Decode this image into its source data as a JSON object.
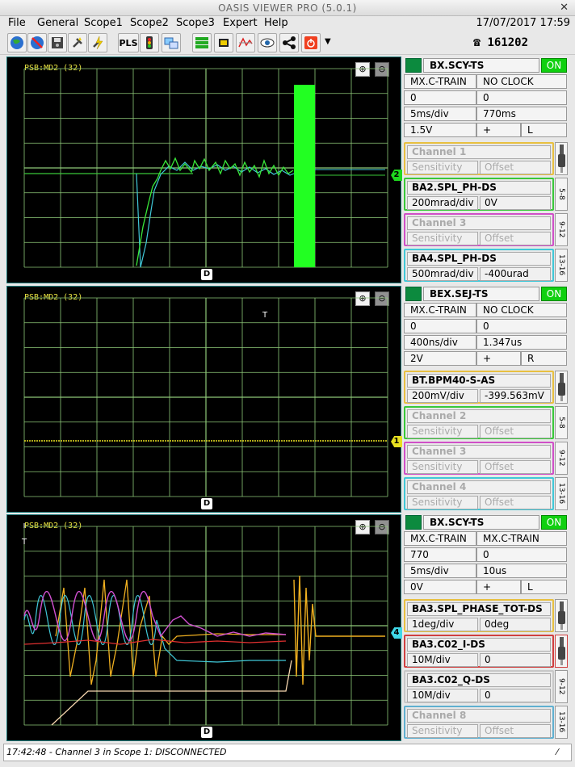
{
  "app": {
    "title": "OASIS VIEWER PRO (5.0.1)",
    "datetime": "17/07/2017 17:59",
    "phone": "161202"
  },
  "menu": [
    "File",
    "General",
    "Scope1",
    "Scope2",
    "Scope3",
    "Expert",
    "Help"
  ],
  "toolbar": {
    "pls": "PLS"
  },
  "scopes": [
    {
      "label": "PSB:MD2 (32)",
      "marker": "2",
      "marker_color": "#1ed81e",
      "dmark": "D",
      "side": {
        "timebase": "BX.SCY-TS",
        "state": "ON",
        "r1": [
          "MX.C-TRAIN",
          "NO CLOCK"
        ],
        "r2": [
          "0",
          "0"
        ],
        "r3": [
          "5ms/div",
          "770ms"
        ],
        "r4": [
          "1.5V",
          "+",
          "L"
        ],
        "channels": [
          {
            "name": "Channel 1",
            "sens": "Sensitivity",
            "off": "Offset",
            "enabled": false,
            "color": "#e8c040"
          },
          {
            "name": "BA2.SPL_PH-DS",
            "sens": "200mrad/div",
            "off": "0V",
            "enabled": true,
            "color": "#39c839"
          },
          {
            "name": "Channel 3",
            "sens": "Sensitivity",
            "off": "Offset",
            "enabled": false,
            "color": "#d050c8"
          },
          {
            "name": "BA4.SPL_PH-DS",
            "sens": "500mrad/div",
            "off": "-400urad",
            "enabled": true,
            "color": "#40c8d8"
          }
        ],
        "tabs": [
          "5-8",
          "9-12",
          "13-16"
        ]
      }
    },
    {
      "label": "PSB:MD2 (32)",
      "marker": "1",
      "marker_color": "#e8e020",
      "dmark": "D",
      "trigger": "T",
      "side": {
        "timebase": "BEX.SEJ-TS",
        "state": "ON",
        "r1": [
          "MX.C-TRAIN",
          "NO CLOCK"
        ],
        "r2": [
          "0",
          "0"
        ],
        "r3": [
          "400ns/div",
          "1.347us"
        ],
        "r4": [
          "2V",
          "+",
          "R"
        ],
        "channels": [
          {
            "name": "BT.BPM40-S-AS",
            "sens": "200mV/div",
            "off": "-399.563mV",
            "enabled": true,
            "color": "#e8c040"
          },
          {
            "name": "Channel 2",
            "sens": "Sensitivity",
            "off": "Offset",
            "enabled": false,
            "color": "#39c839"
          },
          {
            "name": "Channel 3",
            "sens": "Sensitivity",
            "off": "Offset",
            "enabled": false,
            "color": "#d050c8"
          },
          {
            "name": "Channel 4",
            "sens": "Sensitivity",
            "off": "Offset",
            "enabled": false,
            "color": "#40c8d8"
          }
        ],
        "tabs": [
          "5-8",
          "9-12",
          "13-16"
        ]
      }
    },
    {
      "label": "PSB:MD2 (32)",
      "marker": "4",
      "marker_color": "#40d8e8",
      "dmark": "D",
      "trigger": "T",
      "side": {
        "timebase": "BX.SCY-TS",
        "state": "ON",
        "r1": [
          "MX.C-TRAIN",
          "MX.C-TRAIN"
        ],
        "r2": [
          "770",
          "0"
        ],
        "r3": [
          "5ms/div",
          "10us"
        ],
        "r4": [
          "0V",
          "+",
          "L"
        ],
        "channels": [
          {
            "name": "BA3.SPL_PHASE_TOT-DS",
            "sens": "1deg/div",
            "off": "0deg",
            "enabled": true,
            "color": "#e8c040"
          },
          {
            "name": "BA3.C02_I-DS",
            "sens": "10M/div",
            "off": "0",
            "enabled": true,
            "color": "#d04040"
          },
          {
            "name": "BA3.C02_Q-DS",
            "sens": "10M/div",
            "off": "0",
            "enabled": true,
            "color": "#c8c8c8"
          },
          {
            "name": "Channel 8",
            "sens": "Sensitivity",
            "off": "Offset",
            "enabled": false,
            "color": "#60b0d0"
          }
        ],
        "tabs": [
          "5-8",
          "9-12",
          "13-16"
        ]
      }
    }
  ],
  "status": {
    "text": "17:42:48 - Channel 3 in Scope 1: DISCONNECTED",
    "corner": "⁄"
  },
  "colors": {
    "grid": "#8ec878",
    "bg": "#000000"
  }
}
